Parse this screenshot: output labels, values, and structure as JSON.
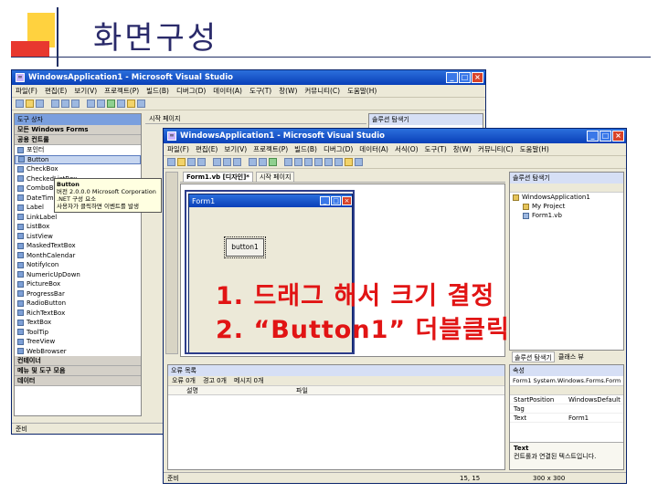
{
  "slide": {
    "title": "화면구성",
    "colors": {
      "accent_yellow": "#ffd23f",
      "accent_red": "#e8382f",
      "line_navy": "#223066",
      "instruction_red": "#e11414"
    }
  },
  "back_window": {
    "title": "WindowsApplication1 - Microsoft Visual Studio",
    "menu": [
      "파일(F)",
      "편집(E)",
      "보기(V)",
      "프로젝트(P)",
      "빌드(B)",
      "디버그(D)",
      "데이터(A)",
      "도구(T)",
      "창(W)",
      "커뮤니티(C)",
      "도움말(H)"
    ],
    "toolbox_title": "도구 상자",
    "toolbox_section": "모든 Windows Forms",
    "toolbox_common": "공용 컨트롤",
    "toolbox_items": [
      "포인터",
      "Button",
      "CheckBox",
      "CheckedListBox",
      "ComboBox",
      "DateTimePicker",
      "Label",
      "LinkLabel",
      "ListBox",
      "ListView",
      "MaskedTextBox",
      "MonthCalendar",
      "NotifyIcon",
      "NumericUpDown",
      "PictureBox",
      "ProgressBar",
      "RadioButton",
      "RichTextBox",
      "TextBox",
      "ToolTip",
      "TreeView",
      "WebBrowser"
    ],
    "toolbox_footer_sections": [
      "컨테이너",
      "메뉴 및 도구 모음",
      "데이터"
    ],
    "tooltip_lines": [
      "Button",
      "버전 2.0.0.0 Microsoft Corporation",
      ".NET 구성 요소"
    ],
    "tooltip_hint": "사용자가 클릭하면 이벤트를 발생",
    "doc_tab": "시작 페이지",
    "solution_title": "솔루션 탐색기",
    "status": "준비"
  },
  "front_window": {
    "title": "WindowsApplication1 - Microsoft Visual Studio",
    "menu": [
      "파일(F)",
      "편집(E)",
      "보기(V)",
      "프로젝트(P)",
      "빌드(B)",
      "디버그(D)",
      "데이터(A)",
      "서식(O)",
      "도구(T)",
      "창(W)",
      "커뮤니티(C)",
      "도움말(H)"
    ],
    "doc_tabs": [
      "Form1.vb [디자인]*",
      "시작 페이지"
    ],
    "form_title": "Form1",
    "button_text": "button1",
    "solution_title": "솔루션 탐색기",
    "solution_items": [
      "WindowsApplication1",
      "My Project",
      "Form1.vb"
    ],
    "error_list_title": "오류 목록",
    "error_list_toolbar": [
      "오류 0개",
      "경고 0개",
      "메시지 0개"
    ],
    "error_list_header": [
      "설명",
      "파일"
    ],
    "properties_title": "속성",
    "properties_object": "Form1 System.Windows.Forms.Form",
    "properties": [
      {
        "name": "StartPosition",
        "value": "WindowsDefault"
      },
      {
        "name": "Tag",
        "value": ""
      },
      {
        "name": "Text",
        "value": "Form1"
      }
    ],
    "properties_desc_title": "Text",
    "properties_desc": "컨트롤과 연결된 텍스트입니다.",
    "panel_tabs": [
      "솔루션 탐색기",
      "클래스 뷰"
    ],
    "status": "준비",
    "status_pos": "15, 15",
    "status_size": "300 x 300"
  },
  "instructions": {
    "line1": "1. 드래그 해서 크기 결정",
    "line2": "2. “Button1” 더블클릭"
  }
}
